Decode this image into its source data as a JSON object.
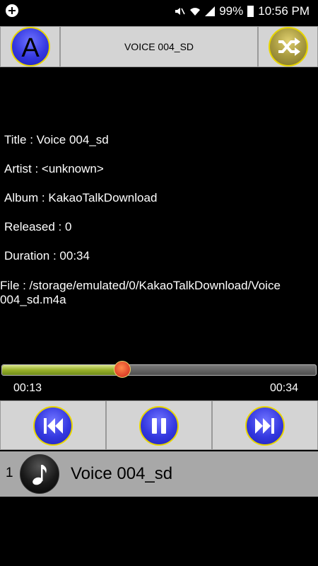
{
  "status_bar": {
    "battery": "99%",
    "time": "10:56 PM"
  },
  "header": {
    "title": "VOICE 004_SD",
    "left_button_letter": "A",
    "right_button_icon": "shuffle-icon"
  },
  "track_info": {
    "title_line": "Title  : Voice 004_sd",
    "artist_line": "Artist  : <unknown>",
    "album_line": "Album : KakaoTalkDownload",
    "released_line": "Released : 0",
    "duration_line": "Duration :  00:34",
    "file_line": " File : /storage/emulated/0/KakaoTalkDownload/Voice 004_sd.m4a"
  },
  "playback": {
    "current_time": "00:13",
    "total_time": "00:34",
    "progress_fraction": 0.3824
  },
  "controls": {
    "prev_icon": "skip-previous-icon",
    "pause_icon": "pause-icon",
    "next_icon": "skip-next-icon"
  },
  "playlist": {
    "items": [
      {
        "number": "1",
        "title": "Voice 004_sd",
        "icon": "music-note-icon"
      }
    ]
  },
  "colors": {
    "button_blue": "#3438e0",
    "button_border": "#e8d600",
    "seek_fill": "#98b02a",
    "seek_thumb": "#e0442a",
    "panel_gray": "#d4d4d4",
    "playlist_gray": "#a8a8a8"
  }
}
